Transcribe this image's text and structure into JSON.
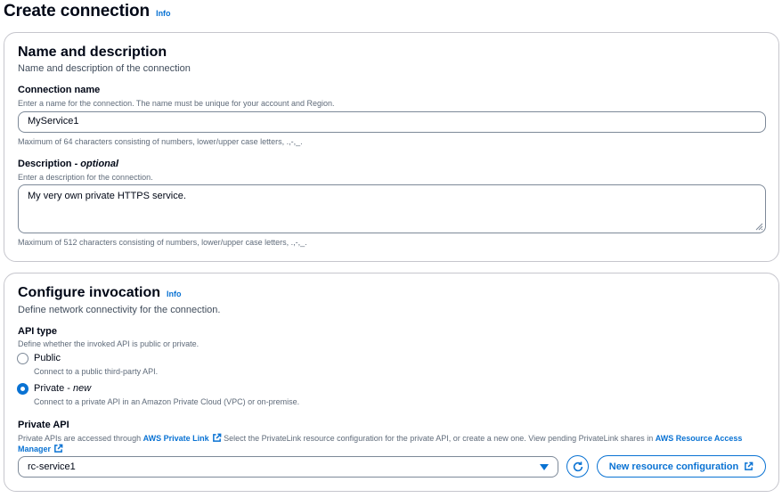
{
  "page": {
    "title": "Create connection",
    "info": "Info"
  },
  "name_section": {
    "title": "Name and description",
    "description": "Name and description of the connection",
    "connection_name": {
      "label": "Connection name",
      "description": "Enter a name for the connection. The name must be unique for your account and Region.",
      "value": "MyService1",
      "constraint": "Maximum of 64 characters consisting of numbers, lower/upper case letters, .,-,_."
    },
    "description_field": {
      "label": "Description - ",
      "label_optional": "optional",
      "description": "Enter a description for the connection.",
      "value": "My very own private HTTPS service.",
      "constraint": "Maximum of 512 characters consisting of numbers, lower/upper case letters, .,-,_."
    }
  },
  "invocation_section": {
    "title": "Configure invocation",
    "info": "Info",
    "description": "Define network connectivity for the connection.",
    "api_type": {
      "label": "API type",
      "description": "Define whether the invoked API is public or private.",
      "options": [
        {
          "label": "Public",
          "label_suffix": "",
          "description": "Connect to a public third-party API.",
          "selected": false
        },
        {
          "label": "Private - ",
          "label_suffix": "new",
          "description": "Connect to a private API in an Amazon Private Cloud (VPC) or on-premise.",
          "selected": true
        }
      ]
    },
    "private_api": {
      "label": "Private API",
      "desc_part1": "Private APIs are accessed through ",
      "link1": "AWS Private Link",
      "desc_part2": " Select the PrivateLink resource configuration for the private API, or create a new one. View pending PrivateLink shares in ",
      "link2": "AWS Resource Access Manager",
      "selected_value": "rc-service1",
      "refresh_icon": "refresh-icon",
      "new_button": "New resource configuration"
    }
  },
  "colors": {
    "accent": "#0972d3",
    "border": "#7d8998",
    "text": "#000716",
    "muted": "#5f6b7a"
  }
}
